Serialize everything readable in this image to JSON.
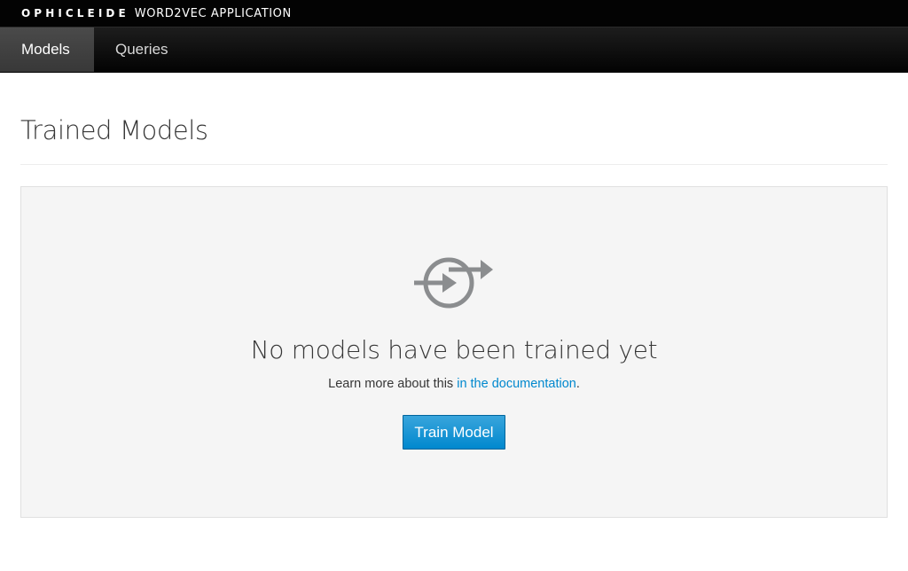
{
  "header": {
    "brand_name": "OPHICLEIDE",
    "brand_sub": "WORD2VEC APPLICATION"
  },
  "nav": {
    "items": [
      {
        "label": "Models",
        "active": true
      },
      {
        "label": "Queries",
        "active": false
      }
    ]
  },
  "main": {
    "title": "Trained Models",
    "empty_state": {
      "icon": "exchange-icon",
      "title": "No models have been trained yet",
      "text_before": "Learn more about this ",
      "link_text": "in the documentation",
      "text_after": ".",
      "button_label": "Train Model"
    }
  },
  "colors": {
    "topbar": "#030303",
    "accent": "#0088ce",
    "icon": "#8b8d8f",
    "panel": "#f5f5f5"
  }
}
